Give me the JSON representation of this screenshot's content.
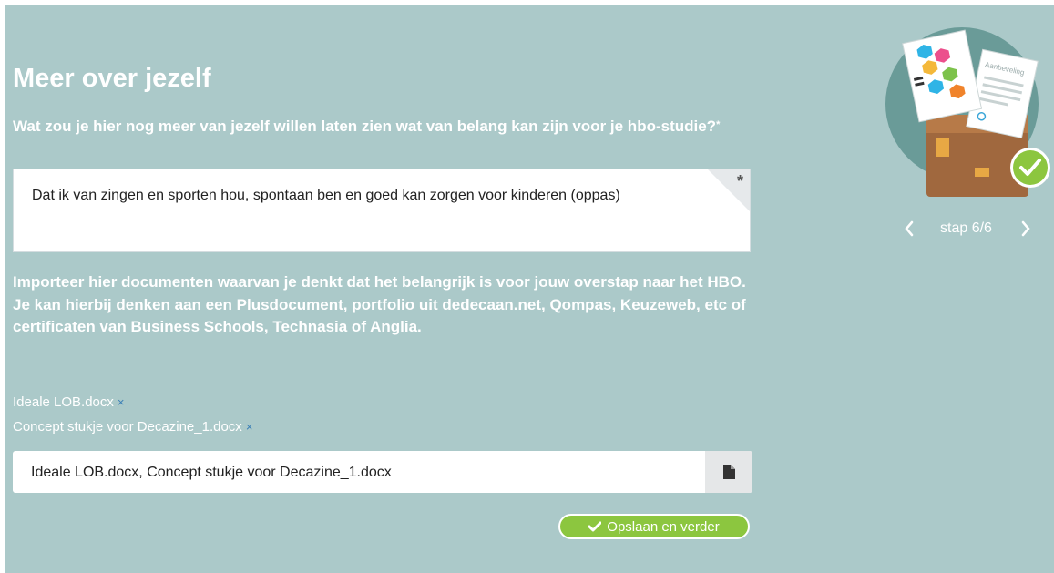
{
  "page": {
    "title": "Meer over jezelf",
    "question": "Wat zou je hier nog meer van jezelf willen laten zien wat van belang kan zijn voor je hbo-studie?",
    "required_mark": "*"
  },
  "textarea": {
    "value": "Dat ik van zingen en sporten hou, spontaan ben en goed kan zorgen voor kinderen (oppas)",
    "required_mark": "*"
  },
  "import": {
    "description": "Importeer hier documenten waarvan je denkt dat het belangrijk is voor jouw overstap naar het HBO. Je kan hierbij denken aan een Plusdocument, portfolio uit dedecaan.net, Qompas, Keuzeweb, etc of certificaten van Business Schools, Technasia of Anglia.",
    "files": [
      {
        "name": "Ideale LOB.docx",
        "remove": "×"
      },
      {
        "name": "Concept stukje voor Decazine_1.docx",
        "remove": "×"
      }
    ],
    "input_value": "Ideale LOB.docx, Concept stukje voor Decazine_1.docx",
    "button_icon": "file-icon"
  },
  "actions": {
    "save_label": "Opslaan en verder",
    "save_icon": "check-icon"
  },
  "stepper": {
    "label": "stap 6/6",
    "prev": "‹",
    "next": "›"
  },
  "illustration": {
    "doc_title": "Aanbeveling",
    "status_icon": "check-badge-icon"
  },
  "colors": {
    "background": "#abc9c9",
    "accent_green": "#8cc63f",
    "text_white": "#ffffff"
  }
}
